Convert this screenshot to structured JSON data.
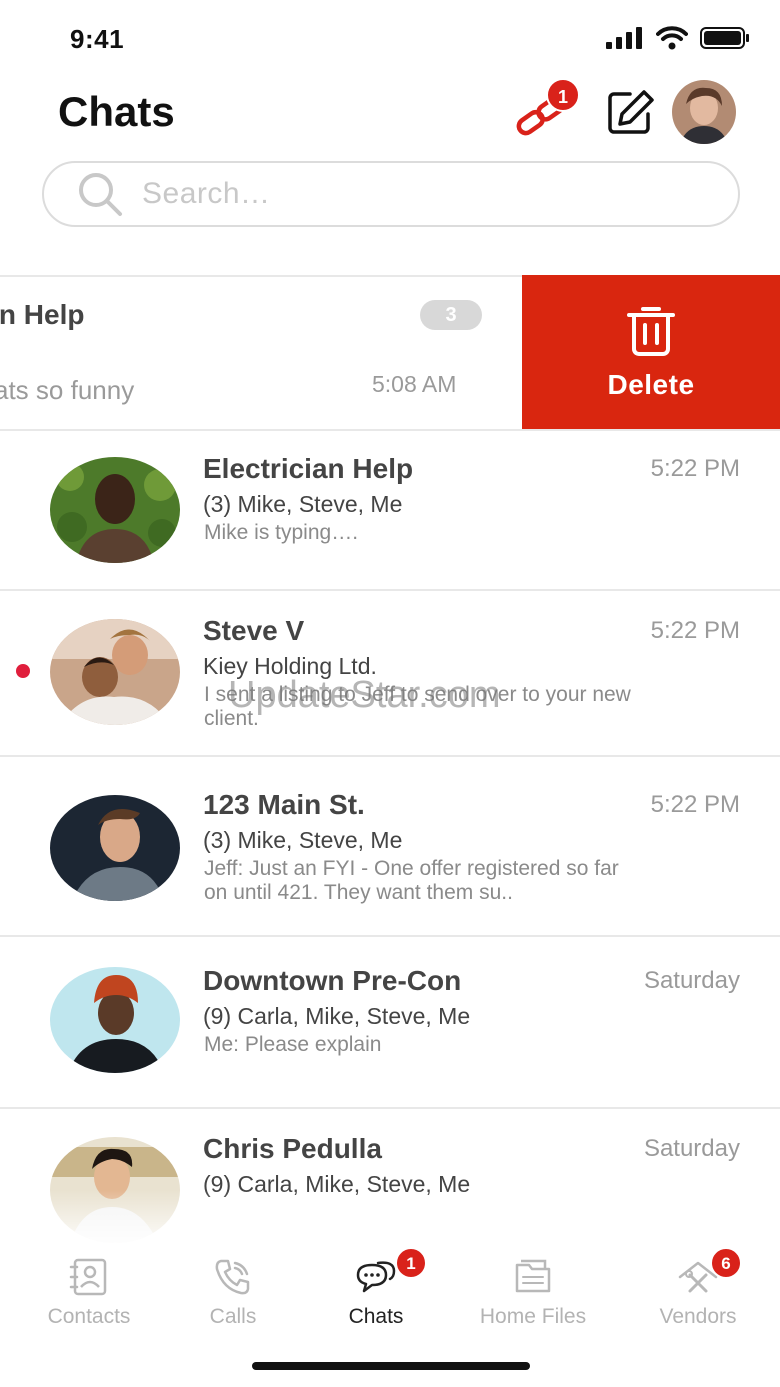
{
  "status_bar": {
    "time": "9:41"
  },
  "header": {
    "title": "Chats",
    "link_badge": "1"
  },
  "search": {
    "placeholder": "Search…"
  },
  "swiped_row": {
    "title": "cian Help",
    "unread_count": "3",
    "preview": "ats so funny",
    "time": "5:08 AM",
    "delete_label": "Delete"
  },
  "chats": [
    {
      "name": "Electrician Help",
      "time": "5:22 PM",
      "members": "(3) Mike, Steve, Me",
      "preview": "Mike is typing…."
    },
    {
      "name": "Steve V",
      "time": "5:22 PM",
      "members": "Kiey Holding Ltd.",
      "preview": "I sent a listing to Jeff to send over to your new client."
    },
    {
      "name": "123 Main St.",
      "time": "5:22 PM",
      "members": "(3) Mike, Steve, Me",
      "preview": "Jeff: Just an FYI - One offer registered so far on until 421. They want them su.."
    },
    {
      "name": "Downtown Pre-Con",
      "time": "Saturday",
      "members": "(9) Carla, Mike, Steve, Me",
      "preview": "Me: Please explain"
    },
    {
      "name": "Chris Pedulla",
      "time": "Saturday",
      "members": "(9) Carla, Mike, Steve, Me",
      "preview": ""
    }
  ],
  "watermark": "UpdateStar.com",
  "tabs": [
    {
      "label": "Contacts",
      "icon": "contacts-icon"
    },
    {
      "label": "Calls",
      "icon": "phone-icon"
    },
    {
      "label": "Chats",
      "icon": "chat-bubbles-icon",
      "badge": "1"
    },
    {
      "label": "Home Files",
      "icon": "folder-icon"
    },
    {
      "label": "Vendors",
      "icon": "tools-house-icon",
      "badge": "6"
    }
  ],
  "colors": {
    "accent_red": "#d9221a",
    "delete_red": "#d9260f",
    "unread_dot": "#e01e3c"
  }
}
